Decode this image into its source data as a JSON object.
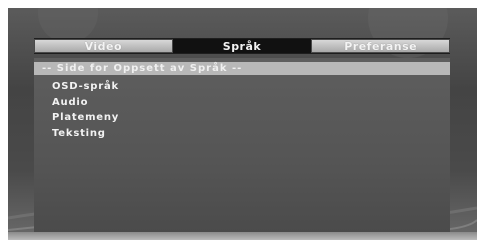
{
  "tabs": [
    {
      "label": "Video",
      "active": false
    },
    {
      "label": "Språk",
      "active": true
    },
    {
      "label": "Preferanse",
      "active": false
    }
  ],
  "page_header": "-- Side for Oppsett av Språk --",
  "menu_items": [
    "OSD-språk",
    "Audio",
    "Platemeny",
    "Teksting"
  ],
  "colors": {
    "active_tab": "#111111",
    "inactive_tab": "#c4c4c4",
    "panel": "#555555",
    "header_row": "#b8b8b8",
    "text": "#f2f2f2"
  }
}
